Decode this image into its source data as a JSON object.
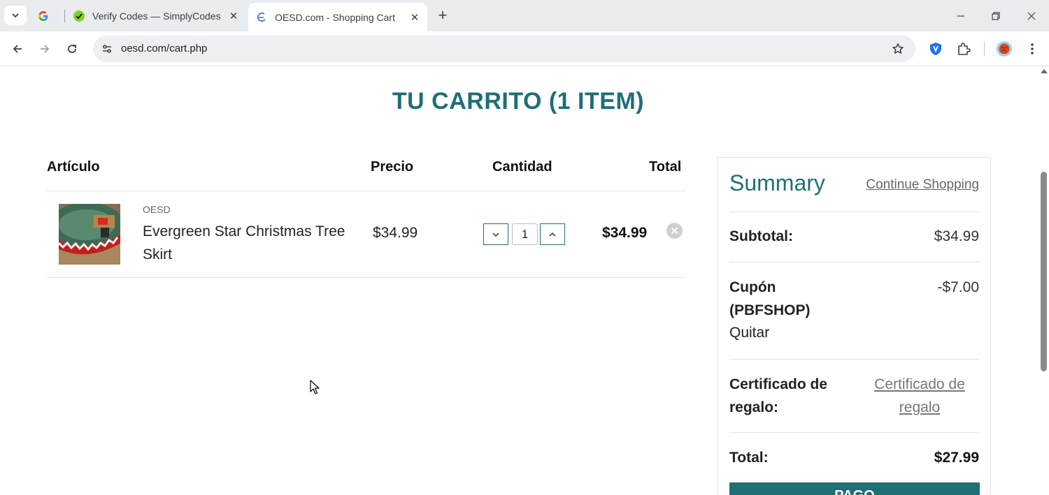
{
  "browser": {
    "tabs": [
      {
        "title": "",
        "favicon": "google-icon"
      },
      {
        "title": "Verify Codes — SimplyCodes",
        "favicon": "simplycodes-icon"
      },
      {
        "title": "OESD.com - Shopping Cart",
        "favicon": "oesd-icon",
        "active": true
      }
    ],
    "url": "oesd.com/cart.php"
  },
  "cart": {
    "title": "TU CARRITO (1 ITEM)",
    "columns": {
      "articulo": "Artículo",
      "precio": "Precio",
      "cantidad": "Cantidad",
      "total": "Total"
    },
    "items": [
      {
        "brand": "OESD",
        "name": "Evergreen Star Christmas Tree Skirt",
        "price": "$34.99",
        "quantity": "1",
        "total": "$34.99"
      }
    ]
  },
  "summary": {
    "title": "Summary",
    "continue_label": "Continue Shopping",
    "subtotal_label": "Subtotal:",
    "subtotal_value": "$34.99",
    "coupon_label": "Cupón (PBFSHOP)",
    "coupon_value": "-$7.00",
    "remove_coupon_label": "Quitar",
    "gift_label": "Certificado de regalo:",
    "gift_link": "Certificado de regalo",
    "total_label": "Total:",
    "total_value": "$27.99",
    "pay_label": "PAGO"
  },
  "colors": {
    "accent": "#1f6f75"
  }
}
